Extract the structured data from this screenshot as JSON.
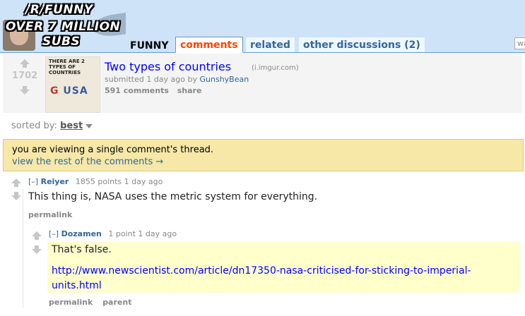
{
  "header": {
    "banner_lines": [
      "/R/FUNNY",
      "OVER 7 MILLION",
      "SUBS"
    ],
    "subreddit": "FUNNY",
    "tabs": [
      {
        "label": "comments",
        "selected": true
      },
      {
        "label": "related",
        "selected": false
      },
      {
        "label": "other discussions (2)",
        "selected": false
      }
    ],
    "search_placeholder": "wa"
  },
  "post": {
    "score": "1702",
    "title": "Two types of countries",
    "domain": "(i.imgur.com)",
    "submitted_prefix": "submitted 1 day ago by",
    "author": "GunshyBean",
    "comments": "591 comments",
    "share": "share",
    "thumbnail": {
      "text": "THERE ARE 2 TYPES OF COUNTRIES",
      "usa_left": "G",
      "usa_right": "USA"
    }
  },
  "sort": {
    "label": "sorted by:",
    "value": "best"
  },
  "notice": {
    "line1": "you are viewing a single comment's thread.",
    "line2": "view the rest of the comments →"
  },
  "comments": [
    {
      "collapse": "[–]",
      "author": "Reiyer",
      "meta": "1855 points 1 day ago",
      "body": "This thing is, NASA uses the metric system for everything.",
      "permalink": "permalink"
    },
    {
      "collapse": "[–]",
      "author": "Dozamen",
      "meta": "1 point 1 day ago",
      "body": "That's false.",
      "link": "http://www.newscientist.com/article/dn17350-nasa-criticised-for-sticking-to-imperial-units.html",
      "permalink": "permalink",
      "parent": "parent"
    }
  ],
  "colors": {
    "header_bg": "#cee3f8",
    "accent": "#ff4500",
    "link": "#0000ff",
    "notice_bg": "#f7e8a7",
    "highlight_bg": "#ffffcc"
  }
}
